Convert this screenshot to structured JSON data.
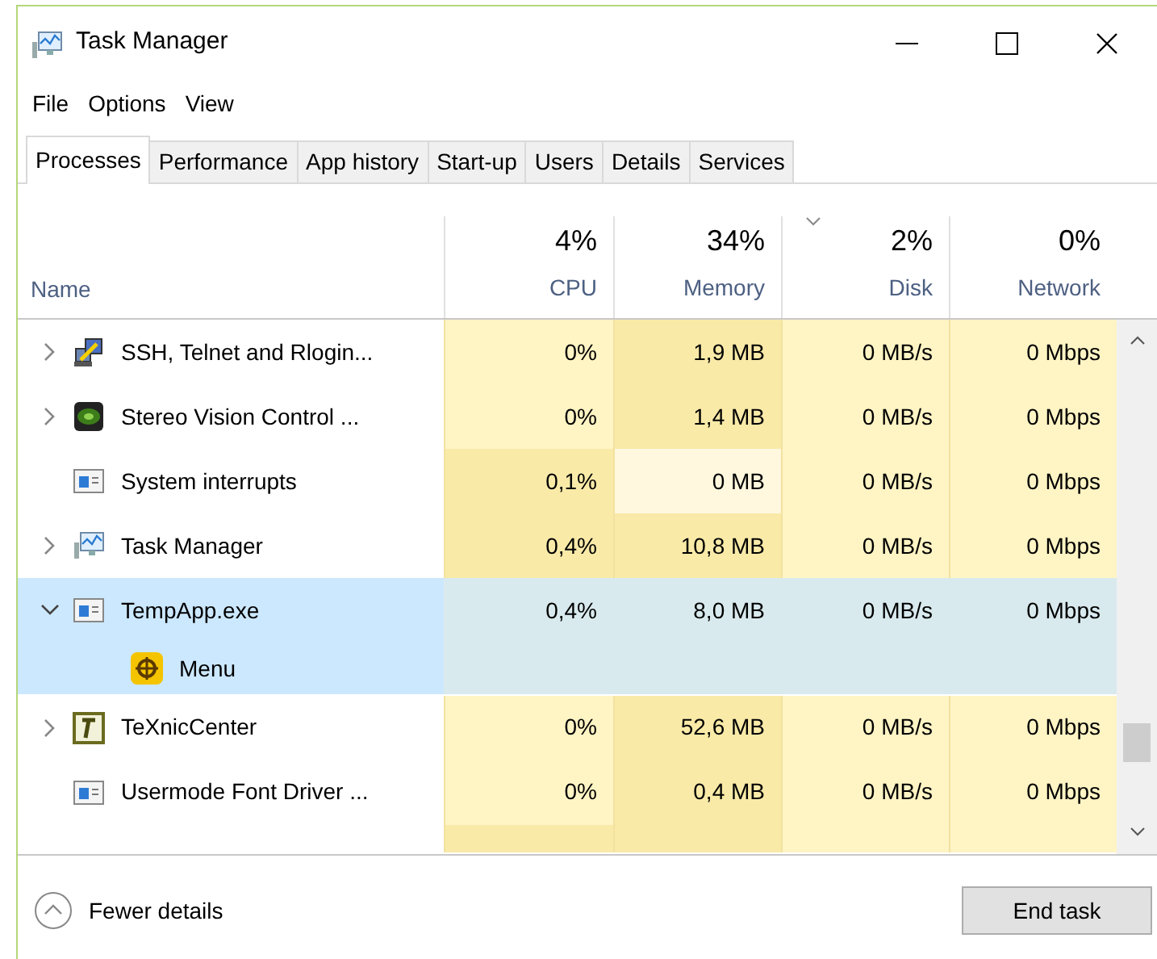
{
  "window": {
    "title": "Task Manager"
  },
  "menu": [
    "File",
    "Options",
    "View"
  ],
  "tabs": [
    {
      "label": "Processes",
      "selected": true
    },
    {
      "label": "Performance",
      "selected": false
    },
    {
      "label": "App history",
      "selected": false
    },
    {
      "label": "Start-up",
      "selected": false
    },
    {
      "label": "Users",
      "selected": false
    },
    {
      "label": "Details",
      "selected": false
    },
    {
      "label": "Services",
      "selected": false
    }
  ],
  "table": {
    "columns": [
      {
        "label": "Name",
        "sorted": false
      },
      {
        "label": "CPU",
        "total": "4%",
        "sorted": false
      },
      {
        "label": "Memory",
        "total": "34%",
        "sorted": false
      },
      {
        "label": "Disk",
        "total": "2%",
        "sorted": true
      },
      {
        "label": "Network",
        "total": "0%",
        "sorted": false
      }
    ],
    "rows": [
      {
        "kind": "process",
        "expanded": false,
        "selected": false,
        "cells": [
          {
            "text": "SSH, Telnet and Rlogin..."
          },
          {
            "text": "0%",
            "color": "#fff4c4"
          },
          {
            "text": "1,9 MB",
            "color": "#f9eaa8"
          },
          {
            "text": "0 MB/s",
            "color": "#fff4c4"
          },
          {
            "text": "0 Mbps",
            "color": "#fff4c4"
          }
        ]
      },
      {
        "kind": "process",
        "expanded": false,
        "selected": false,
        "cells": [
          {
            "text": "Stereo Vision Control ..."
          },
          {
            "text": "0%",
            "color": "#fff4c4"
          },
          {
            "text": "1,4 MB",
            "color": "#f9eaa8"
          },
          {
            "text": "0 MB/s",
            "color": "#fff4c4"
          },
          {
            "text": "0 Mbps",
            "color": "#fff4c4"
          }
        ]
      },
      {
        "kind": "leaf",
        "selected": false,
        "cells": [
          {
            "text": "System interrupts"
          },
          {
            "text": "0,1%",
            "color": "#f9eaa8"
          },
          {
            "text": "0 MB",
            "color": "#fff8de"
          },
          {
            "text": "0 MB/s",
            "color": "#fff4c4"
          },
          {
            "text": "0 Mbps",
            "color": "#fff4c4"
          }
        ]
      },
      {
        "kind": "process",
        "expanded": false,
        "selected": false,
        "cells": [
          {
            "text": "Task Manager"
          },
          {
            "text": "0,4%",
            "color": "#f9eaa8"
          },
          {
            "text": "10,8 MB",
            "color": "#f9eaa8"
          },
          {
            "text": "0 MB/s",
            "color": "#fff4c4"
          },
          {
            "text": "0 Mbps",
            "color": "#fff4c4"
          }
        ]
      },
      {
        "kind": "process",
        "expanded": true,
        "selected": true,
        "cells": [
          {
            "text": "TempApp.exe"
          },
          {
            "text": "0,4%"
          },
          {
            "text": "8,0 MB"
          },
          {
            "text": "0 MB/s"
          },
          {
            "text": "0 Mbps"
          }
        ],
        "children": [
          {
            "kind": "child",
            "selected": true,
            "cells": [
              {
                "text": "Menu"
              }
            ]
          }
        ]
      },
      {
        "kind": "process",
        "expanded": false,
        "selected": false,
        "cells": [
          {
            "text": "TeXnicCenter"
          },
          {
            "text": "0%",
            "color": "#fff4c4"
          },
          {
            "text": "52,6 MB",
            "color": "#f9eaa8"
          },
          {
            "text": "0 MB/s",
            "color": "#fff4c4"
          },
          {
            "text": "0 Mbps",
            "color": "#fff4c4"
          }
        ]
      },
      {
        "kind": "leaf",
        "selected": false,
        "cells": [
          {
            "text": "Usermode Font Driver ..."
          },
          {
            "text": "0%",
            "color": "#fff4c4"
          },
          {
            "text": "0,4 MB",
            "color": "#f9eaa8"
          },
          {
            "text": "0 MB/s",
            "color": "#fff4c4"
          },
          {
            "text": "0 Mbps",
            "color": "#fff4c4"
          }
        ]
      },
      {
        "kind": "partial",
        "selected": false,
        "cells": [
          null,
          {
            "color": "#f9eaa8"
          },
          {
            "color": "#f9eaa8"
          },
          {
            "color": "#fff4c4"
          },
          {
            "color": "#fff4c4"
          }
        ]
      }
    ]
  },
  "footer": {
    "toggle": "Fewer details",
    "button": "End task"
  }
}
